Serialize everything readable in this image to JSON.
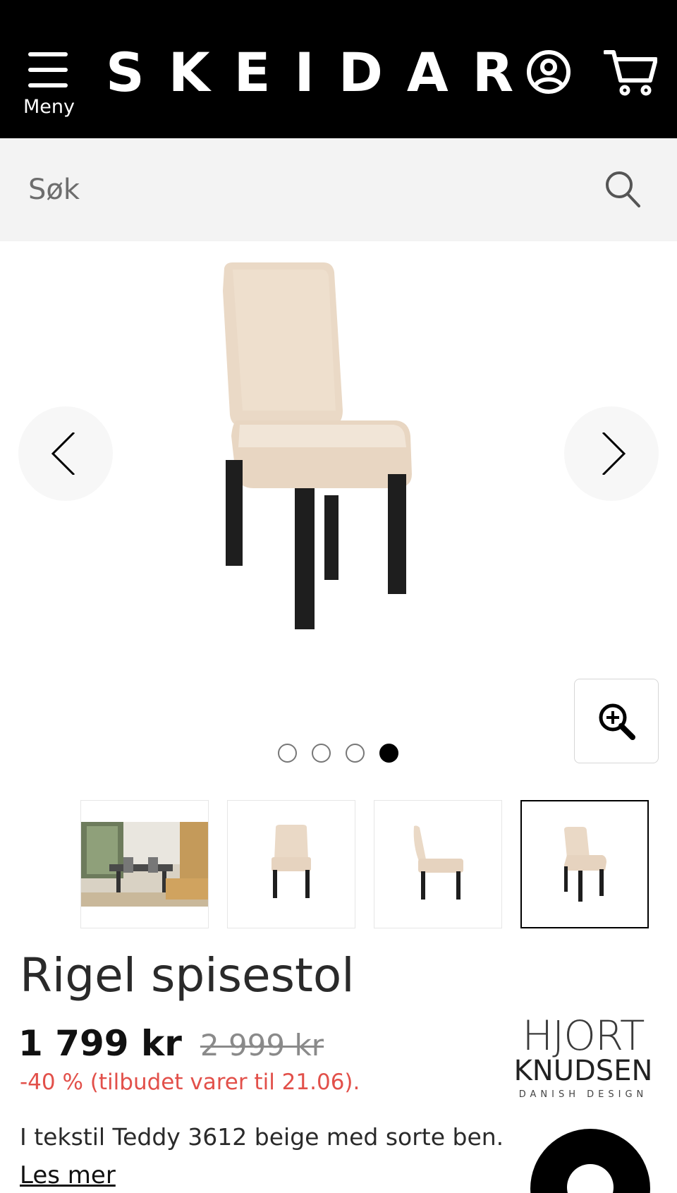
{
  "header": {
    "menu_label": "Meny",
    "logo_text": "SKEIDAR"
  },
  "search": {
    "placeholder": "Søk"
  },
  "gallery": {
    "slide_count": 4,
    "active_slide": 4
  },
  "product": {
    "title": "Rigel spisestol",
    "price": "1 799 kr",
    "old_price": "2 999 kr",
    "discount": "-40 % (tilbudet varer til 21.06).",
    "description": "I tekstil Teddy 3612 beige med sorte ben.",
    "read_more": "Les mer"
  },
  "brand": {
    "line1": "HJORT",
    "line2": "KNUDSEN",
    "line3": "DANISH DESIGN"
  },
  "colors": {
    "header_bg": "#000000",
    "search_bg": "#f3f3f3",
    "discount": "#e2504a",
    "fabric": "#ead9c6",
    "legs": "#1e1e1e"
  },
  "icons": [
    "menu-icon",
    "account-icon",
    "cart-icon",
    "search-icon",
    "chevron-left-icon",
    "chevron-right-icon",
    "zoom-in-icon",
    "chat-icon"
  ]
}
